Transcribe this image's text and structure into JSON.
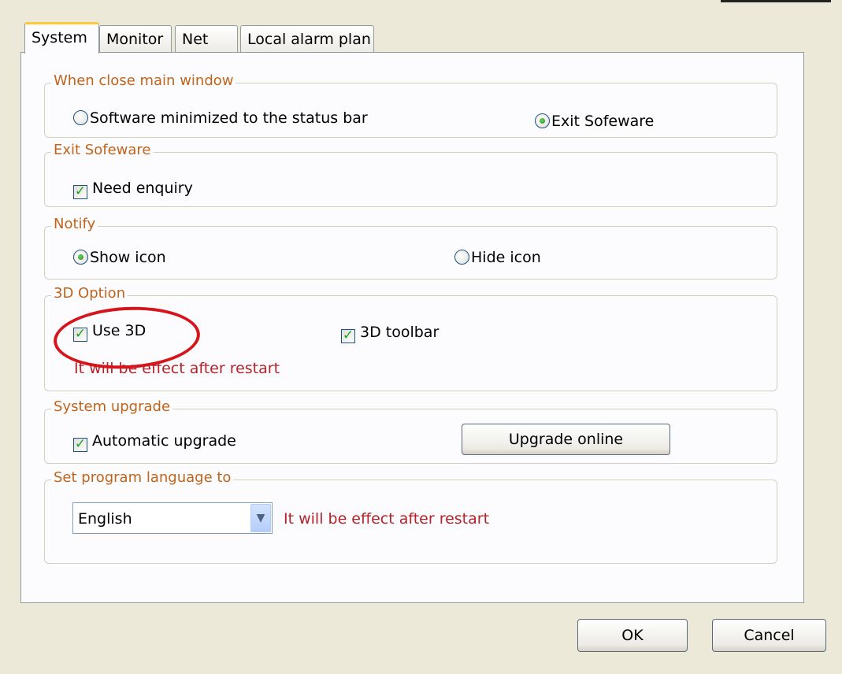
{
  "tabs": [
    {
      "label": "System",
      "active": true
    },
    {
      "label": "Monitor",
      "active": false
    },
    {
      "label": "Net",
      "active": false
    },
    {
      "label": "Local alarm plan",
      "active": false
    }
  ],
  "groups": {
    "close_window": {
      "title": "When close main window",
      "minimize_label": "Software minimized to the status bar",
      "minimize_selected": false,
      "exit_label": "Exit Sofeware",
      "exit_selected": true
    },
    "exit_software": {
      "title": "Exit Sofeware",
      "need_enquiry_label": "Need enquiry",
      "need_enquiry_checked": true
    },
    "notify": {
      "title": "Notify",
      "show_icon_label": "Show icon",
      "show_icon_selected": true,
      "hide_icon_label": "Hide icon",
      "hide_icon_selected": false
    },
    "option_3d": {
      "title": "3D Option",
      "use_3d_label": "Use 3D",
      "use_3d_checked": true,
      "toolbar_3d_label": "3D toolbar",
      "toolbar_3d_checked": true,
      "restart_note": "It will be effect after restart"
    },
    "system_upgrade": {
      "title": "System upgrade",
      "automatic_upgrade_label": "Automatic upgrade",
      "automatic_upgrade_checked": true,
      "upgrade_online_label": "Upgrade online"
    },
    "language": {
      "title": "Set program language to",
      "selected": "English",
      "restart_note": "It will be effect after restart"
    }
  },
  "buttons": {
    "ok": "OK",
    "cancel": "Cancel"
  },
  "colors": {
    "group_title": "#c0641b",
    "warning_text": "#b1232a",
    "highlight_circle": "#d6141c",
    "window_bg": "#ece9d8",
    "panel_bg": "#fcfcfe"
  }
}
